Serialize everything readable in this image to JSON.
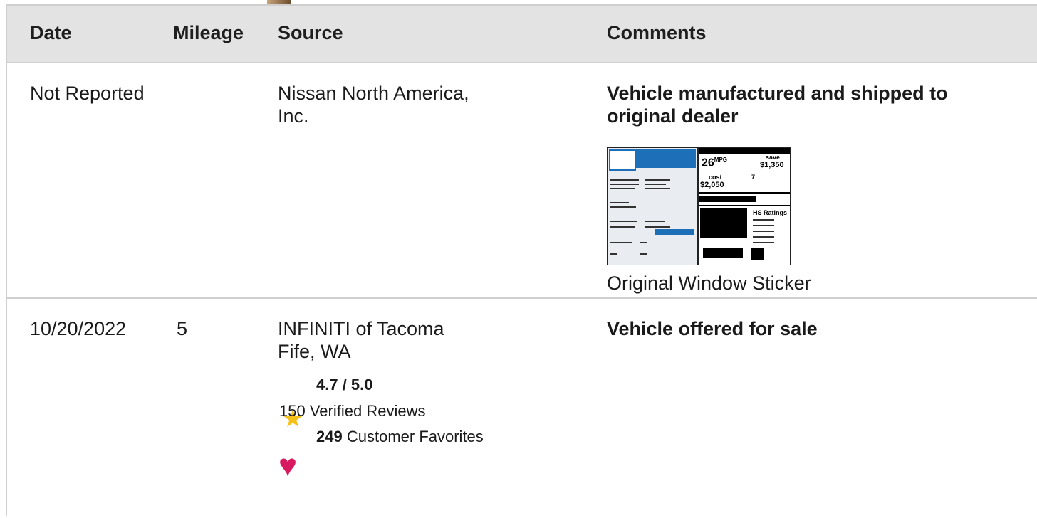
{
  "header": {
    "date": "Date",
    "mileage": "Mileage",
    "source": "Source",
    "comments": "Comments"
  },
  "rows": [
    {
      "date": "Not Reported",
      "mileage": "",
      "source_line1": "Nissan North America,",
      "source_line2": "Inc.",
      "comment_line1": "Vehicle manufactured and shipped to",
      "comment_line2": "original dealer",
      "sticker": {
        "mpg": "26",
        "mpg_unit": "MPG",
        "save_label": "save",
        "save_value": "$1,350",
        "cost_label": "cost",
        "cost_value": "$2,050",
        "ratings_label": "HS Ratings",
        "gauge_value": "7"
      },
      "attachment_caption": "Original Window Sticker"
    },
    {
      "date": "10/20/2022",
      "mileage": "5",
      "source_line1": "INFINITI of Tacoma",
      "source_line2": "Fife, WA",
      "comment_line1": "Vehicle offered for sale",
      "rating": "4.7 / 5.0",
      "reviews_count": "150",
      "reviews_label": "Verified Reviews",
      "favorites_count": "249",
      "favorites_label": "Customer Favorites"
    }
  ],
  "icons": {
    "star": "star-icon",
    "heart": "heart-icon"
  },
  "colors": {
    "header_bg": "#e3e3e3",
    "border": "#cfcfcf",
    "star": "#f5c019",
    "heart": "#d81b60",
    "sticker_blue": "#1d6fb8"
  }
}
